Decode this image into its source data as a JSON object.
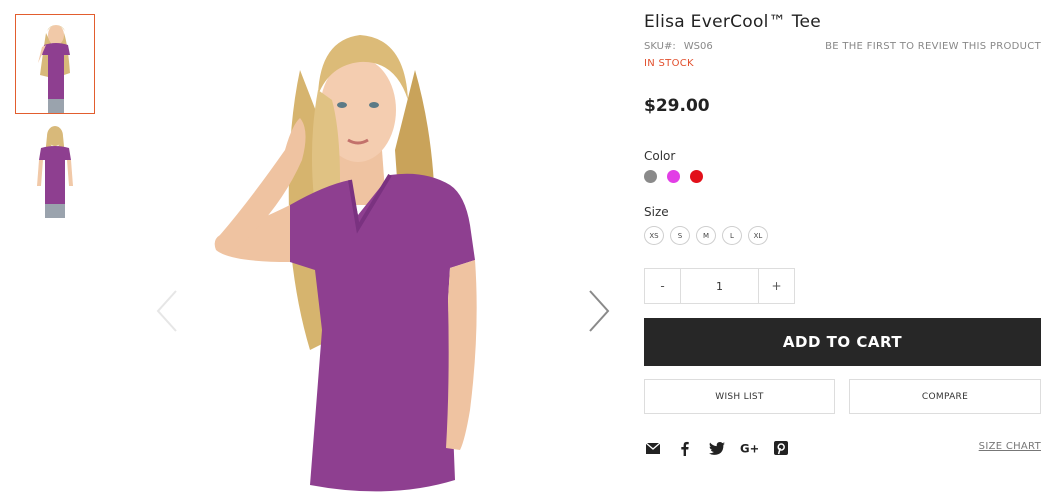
{
  "product": {
    "title": "Elisa EverCool™ Tee",
    "sku_label": "SKU#:",
    "sku_value": "WS06",
    "review_link": "BE THE FIRST TO REVIEW THIS PRODUCT",
    "stock_status": "IN STOCK",
    "price": "$29.00"
  },
  "gallery": {
    "thumbnails": [
      {
        "alt": "front view",
        "active": true
      },
      {
        "alt": "back view",
        "active": false
      }
    ],
    "prev_icon": "chevron-left-icon",
    "next_icon": "chevron-right-icon"
  },
  "options": {
    "color_label": "Color",
    "colors": [
      {
        "name": "gray",
        "hex": "#8a8a8a"
      },
      {
        "name": "purple",
        "hex": "#e23ee6"
      },
      {
        "name": "red",
        "hex": "#e2101a"
      }
    ],
    "size_label": "Size",
    "sizes": [
      "XS",
      "S",
      "M",
      "L",
      "XL"
    ]
  },
  "quantity": {
    "minus": "-",
    "value": "1",
    "plus": "+"
  },
  "actions": {
    "add_to_cart": "ADD TO CART",
    "wish_list": "WISH LIST",
    "compare": "COMPARE",
    "size_chart": "SIZE CHART"
  },
  "social": [
    "envelope-icon",
    "facebook-icon",
    "twitter-icon",
    "google-plus-icon",
    "pinterest-icon"
  ],
  "colors": {
    "accent": "#e25d2e",
    "stock": "#e2502e",
    "button_dark": "#272727",
    "shirt": "#8e3f90"
  }
}
